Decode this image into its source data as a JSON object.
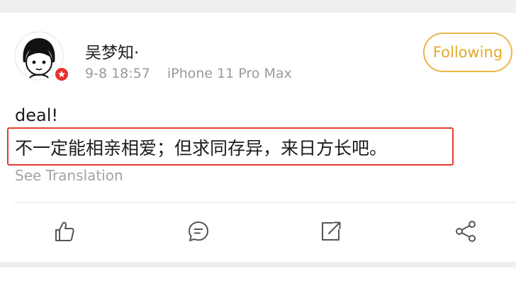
{
  "post": {
    "author": "吴梦知·",
    "timestamp": "9-8 18:57",
    "device": "iPhone 11 Pro Max",
    "follow_label": "Following",
    "text_line1": "deal!",
    "text_line2": "不一定能相亲相爱；但求同存异，来日方长吧。",
    "see_translation": "See Translation"
  },
  "actions": [
    "like-icon",
    "comment-icon",
    "repost-icon",
    "share-icon"
  ],
  "colors": {
    "follow_accent": "#e7a92a",
    "highlight_border": "#e53b30",
    "badge_red": "#e8322a",
    "meta_gray": "#9a9a9a"
  }
}
